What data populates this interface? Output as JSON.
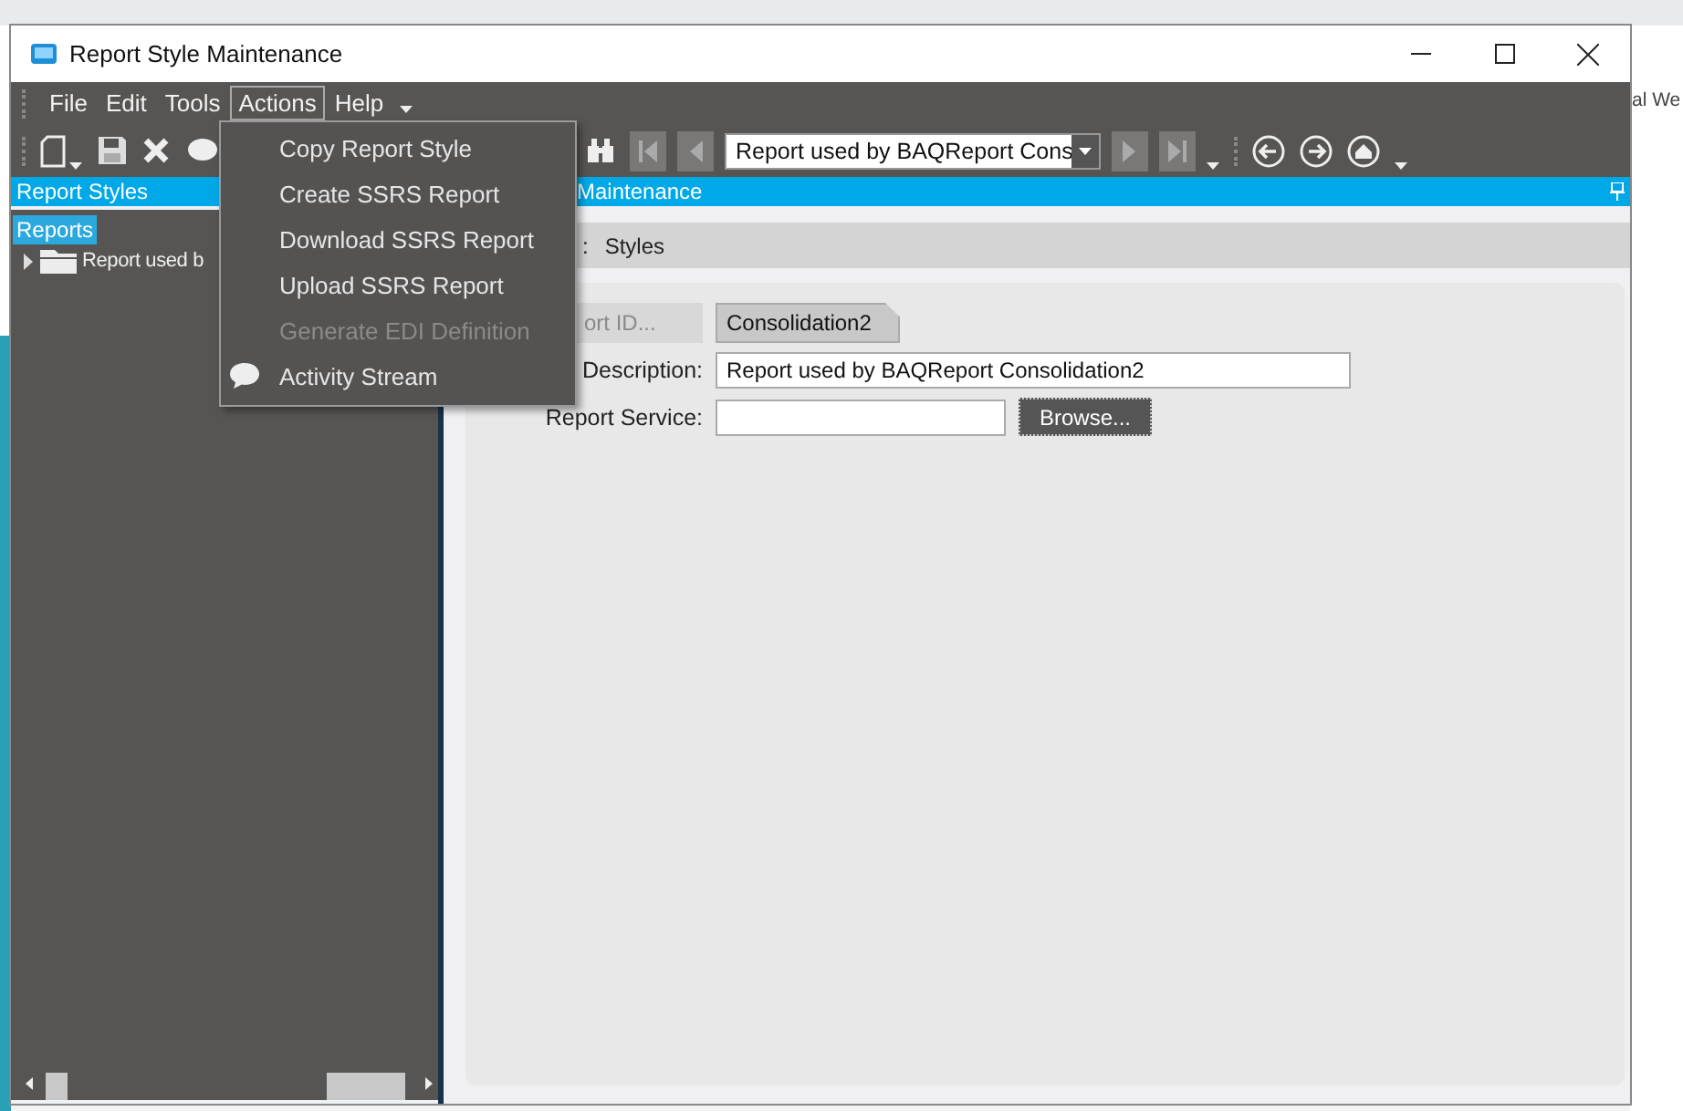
{
  "background": {
    "right_fragment": "al We"
  },
  "window": {
    "title": "Report Style Maintenance"
  },
  "menu_bar": [
    {
      "label": "File",
      "selected": false
    },
    {
      "label": "Edit",
      "selected": false
    },
    {
      "label": "Tools",
      "selected": false
    },
    {
      "label": "Actions",
      "selected": true
    },
    {
      "label": "Help",
      "selected": false
    }
  ],
  "actions_menu": [
    {
      "label": "Copy Report Style",
      "kind": "plain",
      "disabled": false
    },
    {
      "label": "Create SSRS Report",
      "kind": "plain",
      "disabled": false
    },
    {
      "label": "Download SSRS Report",
      "kind": "plain",
      "disabled": false
    },
    {
      "label": "Upload SSRS Report",
      "kind": "plain",
      "disabled": false
    },
    {
      "label": "Generate EDI Definition",
      "kind": "plain",
      "disabled": true
    },
    {
      "label": "Activity Stream",
      "kind": "bubble",
      "disabled": false
    }
  ],
  "toolbar": {
    "record_selector": "Report used by BAQReport Cons"
  },
  "left_panel": {
    "title": "Report Styles",
    "tree": [
      {
        "label": "Reports",
        "selected": true,
        "children": [
          {
            "label": "Report used b",
            "selected": false,
            "expanded": false
          }
        ]
      }
    ]
  },
  "right_panel": {
    "title": "Maintenance",
    "tab_prefix": ":",
    "tabs": [
      "Styles"
    ],
    "form": {
      "report_id_button": "ort ID...",
      "report_id": "Consolidation2",
      "description_label": "Description:",
      "description": "Report used by BAQReport Consolidation2",
      "service_label": "Report Service:",
      "browse_button": "Browse..."
    }
  }
}
